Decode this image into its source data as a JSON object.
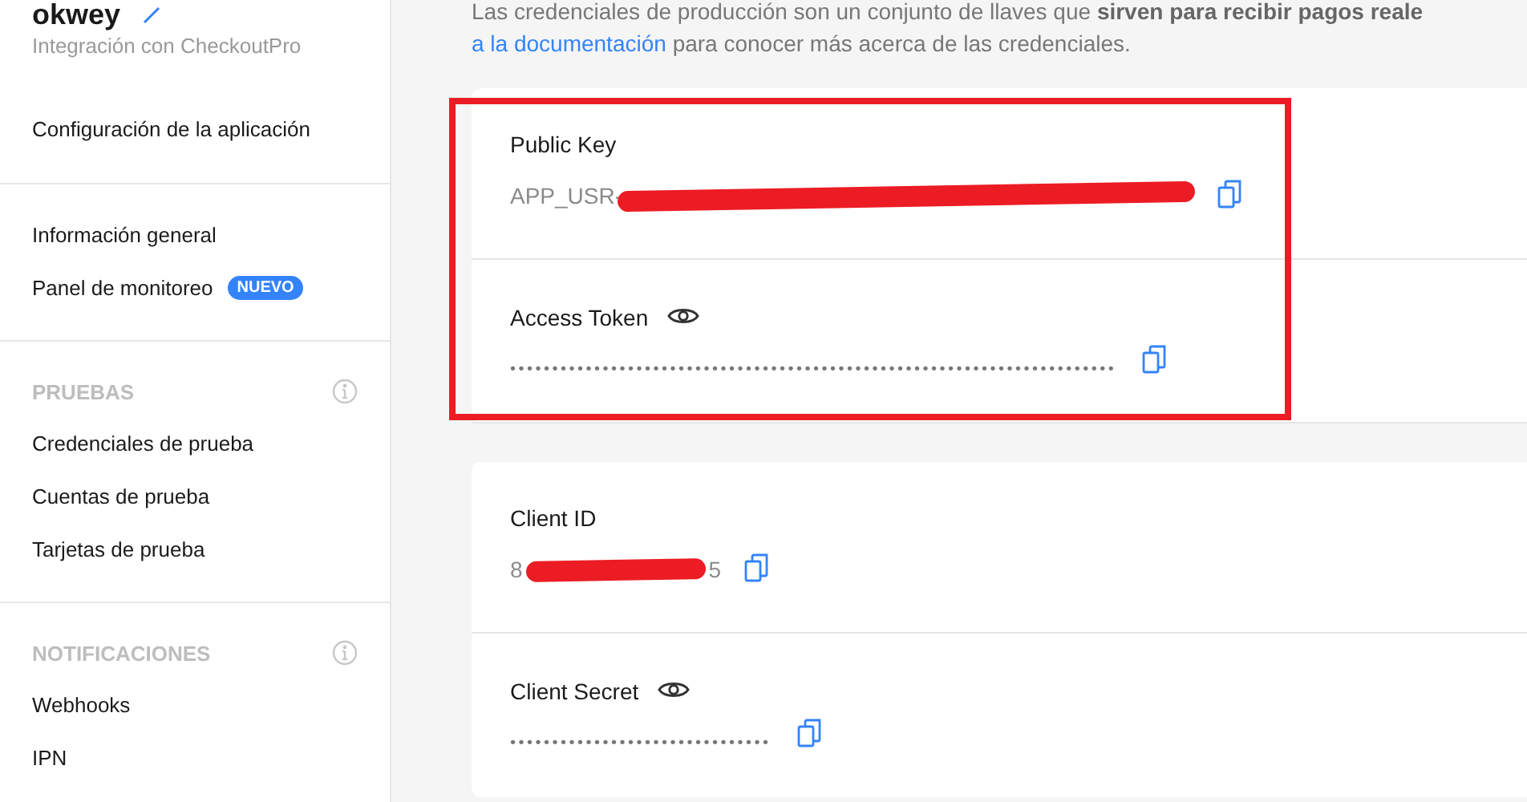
{
  "sidebar": {
    "app_name": "okwey",
    "subtitle": "Integración con CheckoutPro",
    "sections": [
      {
        "items": [
          {
            "label": "Configuración de la aplicación"
          }
        ]
      },
      {
        "items": [
          {
            "label": "Información general"
          },
          {
            "label": "Panel de monitoreo",
            "badge": "NUEVO"
          }
        ]
      },
      {
        "heading": "PRUEBAS",
        "info": true,
        "items": [
          {
            "label": "Credenciales de prueba"
          },
          {
            "label": "Cuentas de prueba"
          },
          {
            "label": "Tarjetas de prueba"
          }
        ]
      },
      {
        "heading": "NOTIFICACIONES",
        "info": true,
        "items": [
          {
            "label": "Webhooks"
          },
          {
            "label": "IPN"
          }
        ]
      }
    ]
  },
  "intro": {
    "text": "Las credenciales de producción son un conjunto de llaves que **sirven para recibir pagos reale**",
    "link": "a la documentación",
    "rest": "para conocer más acerca de las credenciales."
  },
  "cards": [
    {
      "highlighted": true,
      "fields": [
        {
          "label": "Public Key",
          "kind": "shown",
          "value_start": "APP_USR-",
          "redacted": true
        },
        {
          "label": "Access Token",
          "kind": "hidden",
          "value": "••••••••••••••••••••••••••••••••••••••••••••••••••••••••••••••••••••••••"
        }
      ]
    },
    {
      "highlighted": false,
      "fields": [
        {
          "label": "Client ID",
          "kind": "shown",
          "value_start": "8",
          "redacted": true,
          "value_end": "5"
        },
        {
          "label": "Client Secret",
          "kind": "hidden",
          "value": "•••••••••••••••••••••••••••••••"
        }
      ]
    }
  ]
}
